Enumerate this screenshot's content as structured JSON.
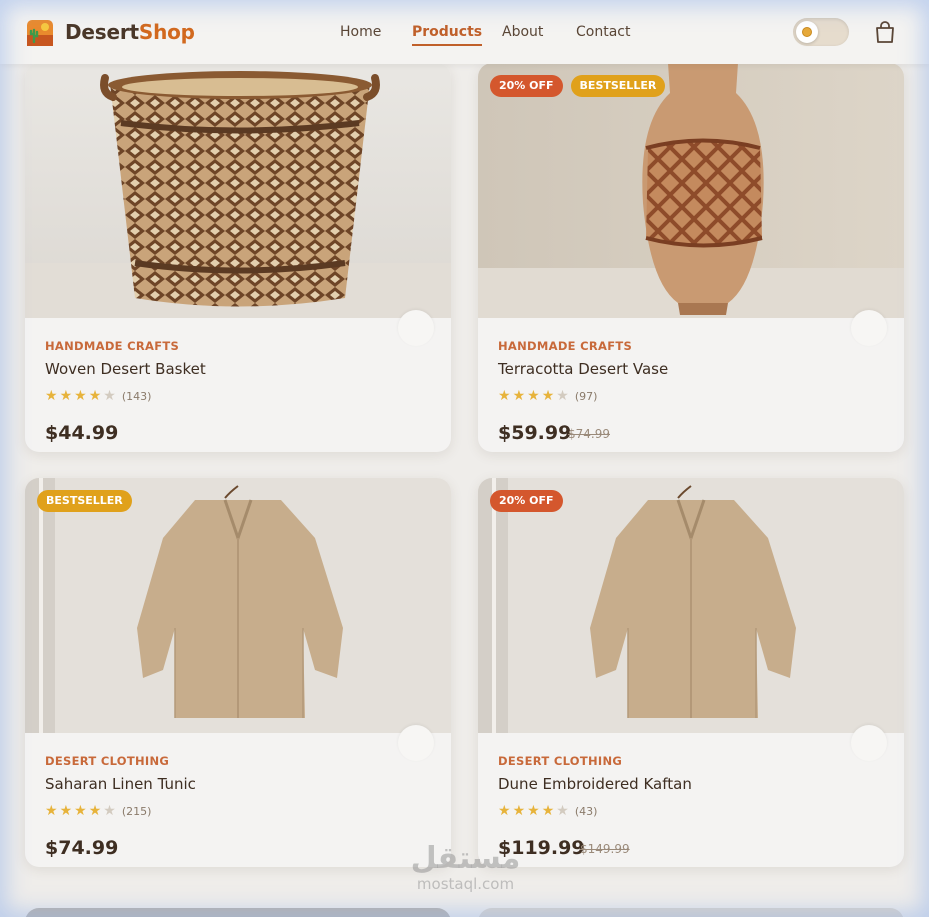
{
  "header": {
    "brand_first": "Desert",
    "brand_second": "Shop",
    "nav": [
      "Home",
      "Products",
      "About",
      "Contact"
    ],
    "active_nav": "Products"
  },
  "theme": {
    "mode": "light",
    "accent": "#d2691e"
  },
  "products": [
    {
      "category": "HANDMADE CRAFTS",
      "title": "Woven Desert Basket",
      "rating": 4,
      "reviews": "(143)",
      "price": "$44.99",
      "old_price": "",
      "badges": []
    },
    {
      "category": "HANDMADE CRAFTS",
      "title": "Terracotta Desert Vase",
      "rating": 4,
      "reviews": "(97)",
      "price": "$59.99",
      "old_price": "$74.99",
      "badges": [
        "20% OFF",
        "BESTSELLER"
      ]
    },
    {
      "category": "DESERT CLOTHING",
      "title": "Saharan Linen Tunic",
      "rating": 4,
      "reviews": "(215)",
      "price": "$74.99",
      "old_price": "",
      "badges": [
        "BESTSELLER"
      ]
    },
    {
      "category": "DESERT CLOTHING",
      "title": "Dune Embroidered Kaftan",
      "rating": 4,
      "reviews": "(43)",
      "price": "$119.99",
      "old_price": "$149.99",
      "badges": [
        "20% OFF"
      ]
    }
  ],
  "watermark": {
    "arabic": "مستقل",
    "latin": "mostaql.com"
  }
}
